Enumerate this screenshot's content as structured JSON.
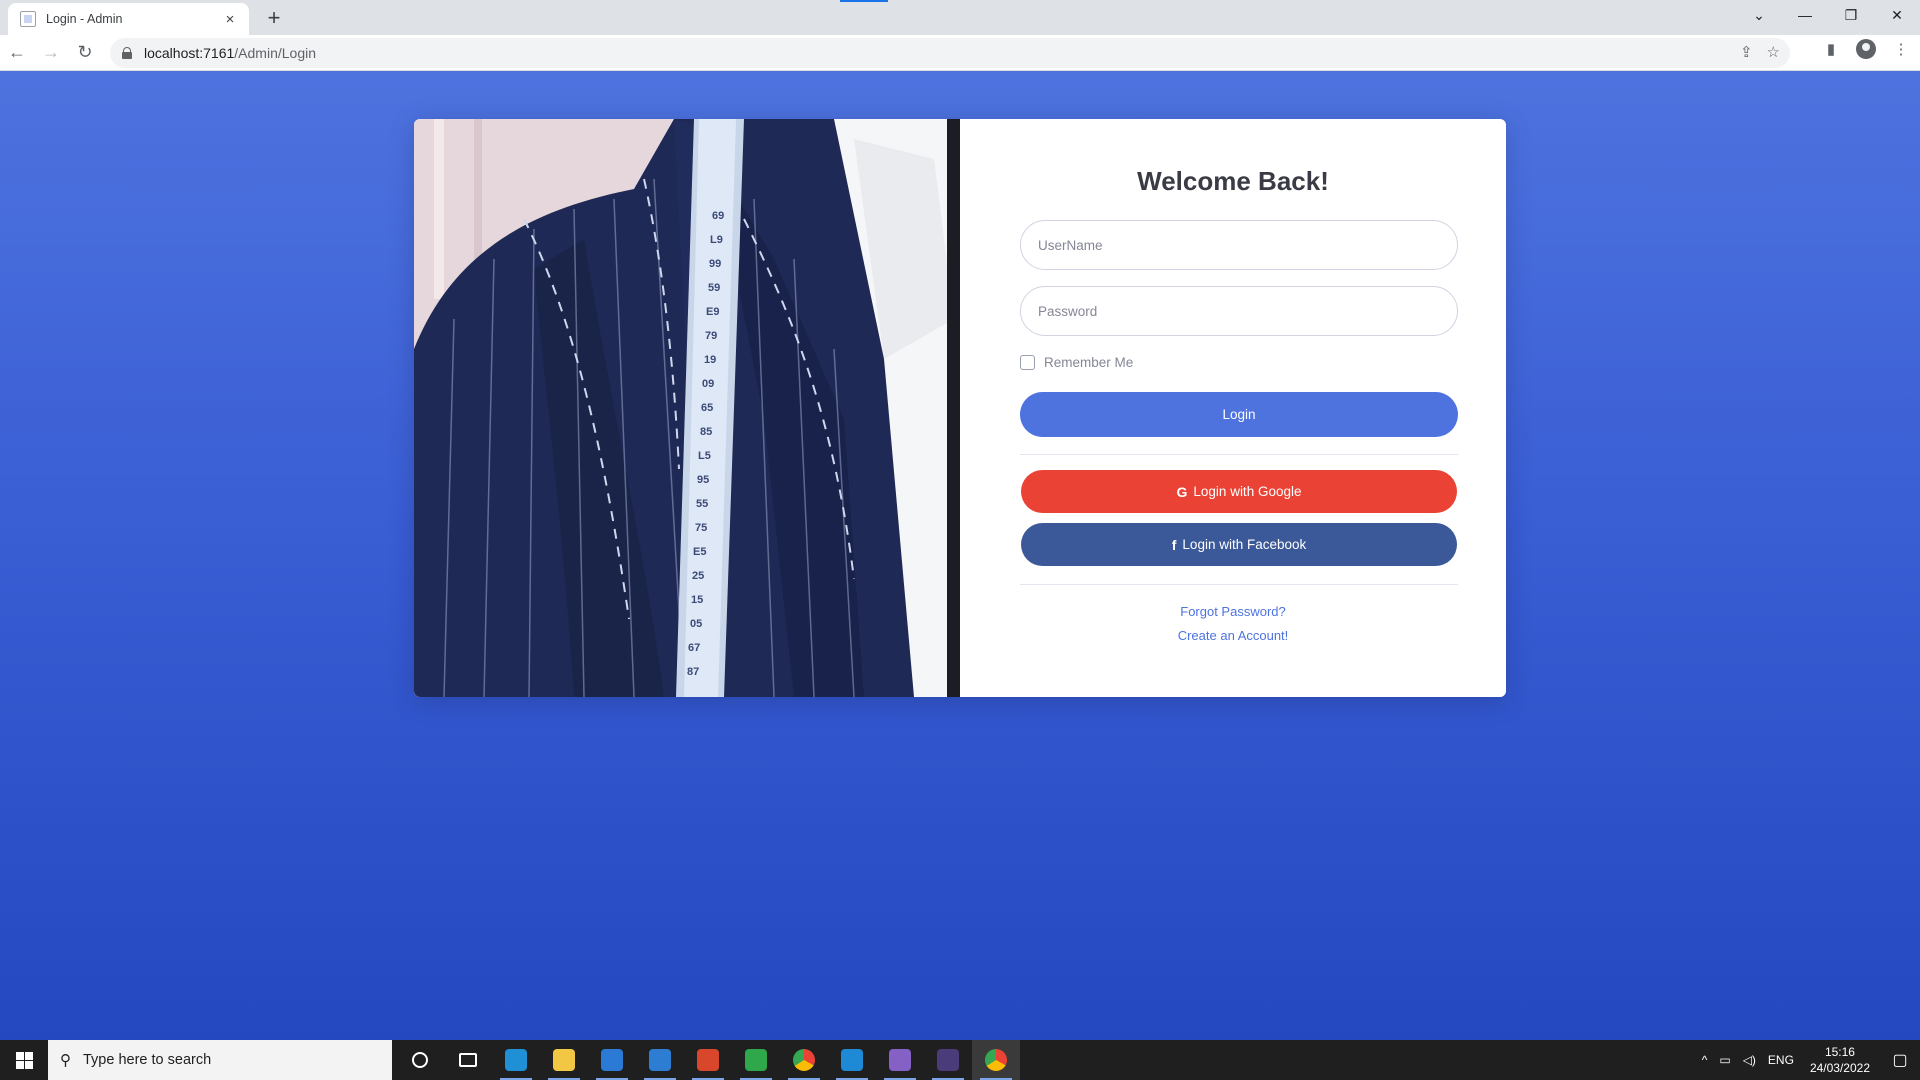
{
  "browser": {
    "tab_title": "Login - Admin",
    "tab_close": "×",
    "new_tab": "+",
    "url_host": "localhost:7161",
    "url_path": "/Admin/Login",
    "window_controls": {
      "tab_search": "⌄",
      "minimize": "—",
      "restore": "❐",
      "close": "✕"
    },
    "nav": {
      "back": "←",
      "forward": "→",
      "reload": "↻"
    }
  },
  "page": {
    "background_color": "#4e73df",
    "form": {
      "title": "Welcome Back!",
      "username_placeholder": "UserName",
      "password_placeholder": "Password",
      "remember_label": "Remember Me",
      "login_label": "Login",
      "google_label": "Login with Google",
      "google_icon": "G",
      "facebook_label": "Login with Facebook",
      "facebook_icon": "f",
      "forgot_link": "Forgot Password?",
      "create_link": "Create an Account!"
    },
    "colors": {
      "primary": "#4e73df",
      "google": "#ea4335",
      "facebook": "#3b5998"
    }
  },
  "taskbar": {
    "search_placeholder": "Type here to search",
    "language": "ENG",
    "time": "15:16",
    "date": "24/03/2022",
    "apps": [
      {
        "name": "cortana",
        "color": "#1f1f1f"
      },
      {
        "name": "task-view",
        "color": "#1f1f1f"
      },
      {
        "name": "edge",
        "color": "#1f8fd6"
      },
      {
        "name": "file-explorer",
        "color": "#f2c744"
      },
      {
        "name": "store",
        "color": "#2a7ad6"
      },
      {
        "name": "mail",
        "color": "#2d7dd2"
      },
      {
        "name": "app-red",
        "color": "#d8472b"
      },
      {
        "name": "app-green",
        "color": "#2ea84a"
      },
      {
        "name": "chrome",
        "color": "#34a853"
      },
      {
        "name": "vscode",
        "color": "#1e8ad6"
      },
      {
        "name": "visual-studio",
        "color": "#8661c5"
      },
      {
        "name": "terminal",
        "color": "#4a3c7a"
      },
      {
        "name": "chrome-active",
        "color": "#ea4335"
      }
    ]
  }
}
